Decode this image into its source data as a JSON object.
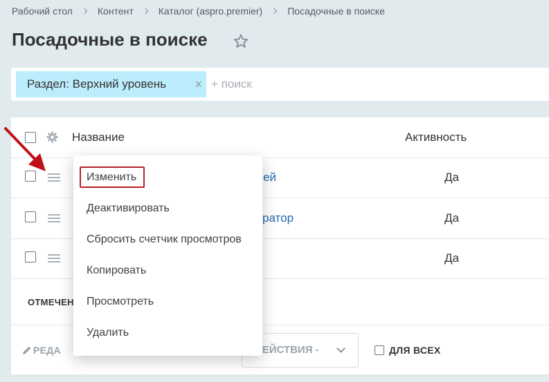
{
  "breadcrumb": [
    "Рабочий стол",
    "Контент",
    "Каталог (aspro.premier)",
    "Посадочные в поиске"
  ],
  "page_title": "Посадочные в поиске",
  "filter": {
    "tag_label": "Раздел: Верхний уровень",
    "close_symbol": "×",
    "search_placeholder": "+ поиск"
  },
  "grid": {
    "columns": {
      "name": "Название",
      "active": "Активность"
    },
    "rows": [
      {
        "name_partial": "ей",
        "active": "Да"
      },
      {
        "name_partial": "ратор",
        "active": "Да"
      },
      {
        "name_partial": "",
        "active": "Да"
      }
    ],
    "marked_label": "ОТМЕЧЕН",
    "footer": {
      "edit_label": "РЕДА",
      "actions_label": "ДЕЙСТВИЯ -",
      "for_all_label": "ДЛЯ ВСЕХ"
    }
  },
  "context_menu": {
    "items": [
      "Изменить",
      "Деактивировать",
      "Сбросить счетчик просмотров",
      "Копировать",
      "Просмотреть",
      "Удалить"
    ]
  },
  "colors": {
    "background": "#e1eaed",
    "filter_tag": "#bcedfc",
    "link": "#2067b0",
    "highlight": "#b81e27"
  }
}
